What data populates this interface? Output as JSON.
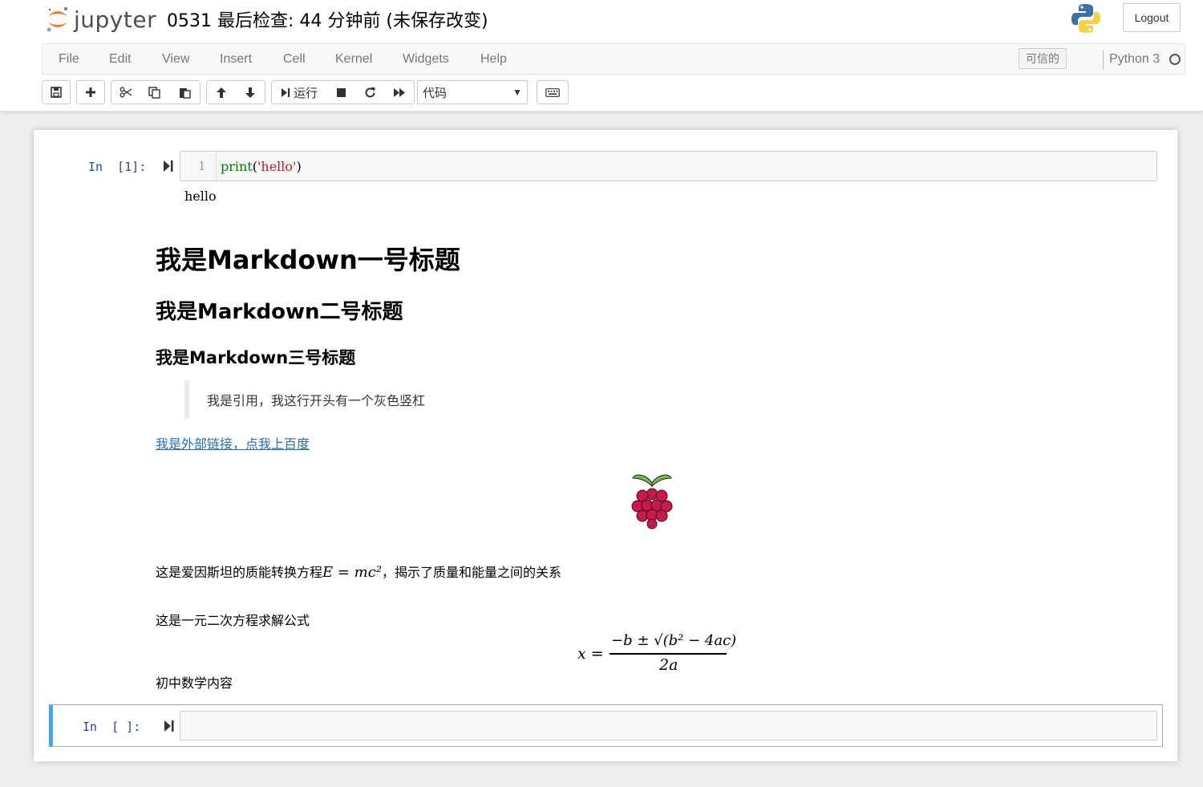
{
  "header": {
    "logo_text": "jupyter",
    "notebook_title": "0531 最后检查: 44 分钟前  (未保存改变)",
    "logout_label": "Logout",
    "python_logo_icon": "python-logo-icon"
  },
  "menubar": {
    "items": [
      "File",
      "Edit",
      "View",
      "Insert",
      "Cell",
      "Kernel",
      "Widgets",
      "Help"
    ],
    "trusted_label": "可信的",
    "kernel_name": "Python 3"
  },
  "toolbar": {
    "run_label": "运行",
    "cell_type": "代码",
    "icons": [
      "save-icon",
      "plus-icon",
      "cut-icon",
      "copy-icon",
      "paste-icon",
      "arrow-up-icon",
      "arrow-down-icon",
      "run-icon",
      "stop-icon",
      "restart-icon",
      "fast-forward-icon",
      "keyboard-icon"
    ]
  },
  "cells": {
    "code1": {
      "prompt": "In  [1]:",
      "line_number": "1",
      "code_fn": "print",
      "code_open": "(",
      "code_str": "'hello'",
      "code_close": ")",
      "output": "hello"
    },
    "markdown": {
      "h1": "我是Markdown一号标题",
      "h2": "我是Markdown二号标题",
      "h3": "我是Markdown三号标题",
      "quote": "我是引用，我这行开头有一个灰色竖杠",
      "link": "我是外部链接，点我上百度",
      "image_icon": "raspberry-pi-logo",
      "einstein_before": "这是爱因斯坦的质能转换方程",
      "einstein_math": "E = mc²",
      "einstein_after": "，揭示了质量和能量之间的关系",
      "quadratic_intro": "这是一元二次方程求解公式",
      "formula_lhs": "x =",
      "formula_numerator": "−b ± √(b² − 4ac)",
      "formula_denominator": "2a",
      "footer_text": "初中数学内容"
    },
    "empty": {
      "prompt": "In  [ ]:"
    }
  },
  "colors": {
    "prompt": "#303f9f",
    "link": "#296eaa",
    "selected_border": "#42a5f5",
    "jupyter_orange": "#f37726"
  }
}
